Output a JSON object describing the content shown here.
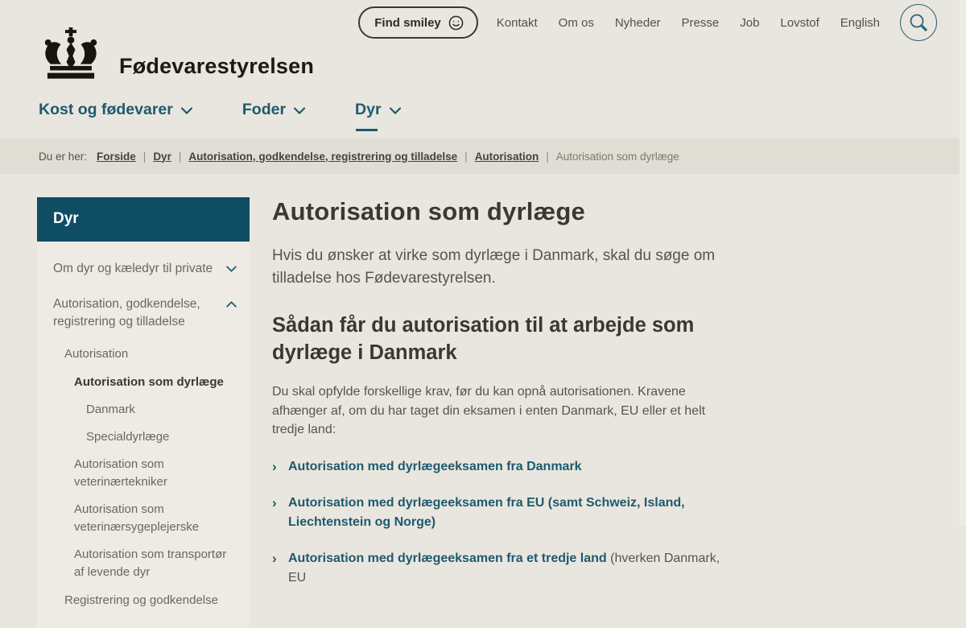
{
  "brand": {
    "name": "Fødevarestyrelsen"
  },
  "header": {
    "find_smiley_label": "Find smiley",
    "nav": [
      "Kontakt",
      "Om os",
      "Nyheder",
      "Presse",
      "Job",
      "Lovstof",
      "English"
    ]
  },
  "mainnav": {
    "items": [
      {
        "label": "Kost og fødevarer",
        "active": false
      },
      {
        "label": "Foder",
        "active": false
      },
      {
        "label": "Dyr",
        "active": true
      }
    ]
  },
  "breadcrumb": {
    "prefix": "Du er her:",
    "links": [
      "Forside",
      "Dyr",
      "Autorisation, godkendelse, registrering og tilladelse",
      "Autorisation"
    ],
    "separator": "|",
    "current": "Autorisation som dyrlæge"
  },
  "sidebar": {
    "title": "Dyr",
    "items": [
      {
        "label": "Om dyr og kæledyr til private",
        "level": 1,
        "chevron": "down"
      },
      {
        "label": "Autorisation, godkendelse, registrering og tilladelse",
        "level": 1,
        "chevron": "up"
      },
      {
        "label": "Autorisation",
        "level": 2
      },
      {
        "label": "Autorisation som dyrlæge",
        "level": 3,
        "active": true
      },
      {
        "label": "Danmark",
        "level": 4
      },
      {
        "label": "Specialdyrlæge",
        "level": 4
      },
      {
        "label": "Autorisation som veterinærtekniker",
        "level": 3
      },
      {
        "label": "Autorisation som veterinærsygeplejerske",
        "level": 3
      },
      {
        "label": "Autorisation som transportør af levende dyr",
        "level": 3
      },
      {
        "label": "Registrering og godkendelse",
        "level": 2
      }
    ]
  },
  "content": {
    "title": "Autorisation som dyrlæge",
    "intro": "Hvis du ønsker at virke som dyrlæge i Danmark, skal du søge om tilladelse hos Fødevarestyrelsen.",
    "section_heading": "Sådan får du autorisation til at arbejde som dyrlæge i Danmark",
    "paragraph": "Du skal opfylde forskellige krav, før du kan opnå autorisationen. Kravene afhænger af, om du har taget din eksamen i enten Danmark, EU eller et helt tredje land:",
    "link_arrow": "›",
    "links": [
      {
        "bold": "Autorisation med dyrlægeeksamen fra Danmark",
        "suffix": ""
      },
      {
        "bold": "Autorisation med dyrlægeeksamen fra EU (samt Schweiz, Island, Liechtenstein og Norge)",
        "suffix": ""
      },
      {
        "bold": "Autorisation med dyrlægeeksamen fra et tredje land",
        "suffix": " (hverken Danmark, EU"
      }
    ]
  },
  "icons": {
    "crown": "crown-icon",
    "smiley": "smiley-icon",
    "search": "search-icon",
    "chevron_down": "chevron-down-icon",
    "chevron_up": "chevron-up-icon"
  },
  "colors": {
    "accent_teal": "#1e5a6d",
    "sidebar_header_bg": "#0f4d64",
    "page_bg": "#e9e6df",
    "breadcrumb_bg": "#e0ddd5",
    "sidebar_bg": "#edebe4",
    "heading_text": "#3a3832",
    "body_text": "#57544c",
    "logo_black": "#1b1a16"
  }
}
